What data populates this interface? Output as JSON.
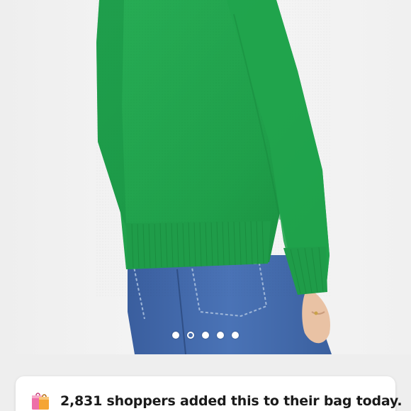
{
  "product_gallery": {
    "image_alt": "Green sweater with blue jeans, back view",
    "dot_count": 5,
    "active_dot_index": 1
  },
  "social_proof": {
    "icon": "shopping-bags-icon",
    "message": "2,831 shoppers added this to their bag today."
  },
  "colors": {
    "sweater_green": "#1fa34a",
    "denim_blue": "#3f66a8",
    "background": "#eeeeee",
    "card_background": "#ffffff"
  }
}
